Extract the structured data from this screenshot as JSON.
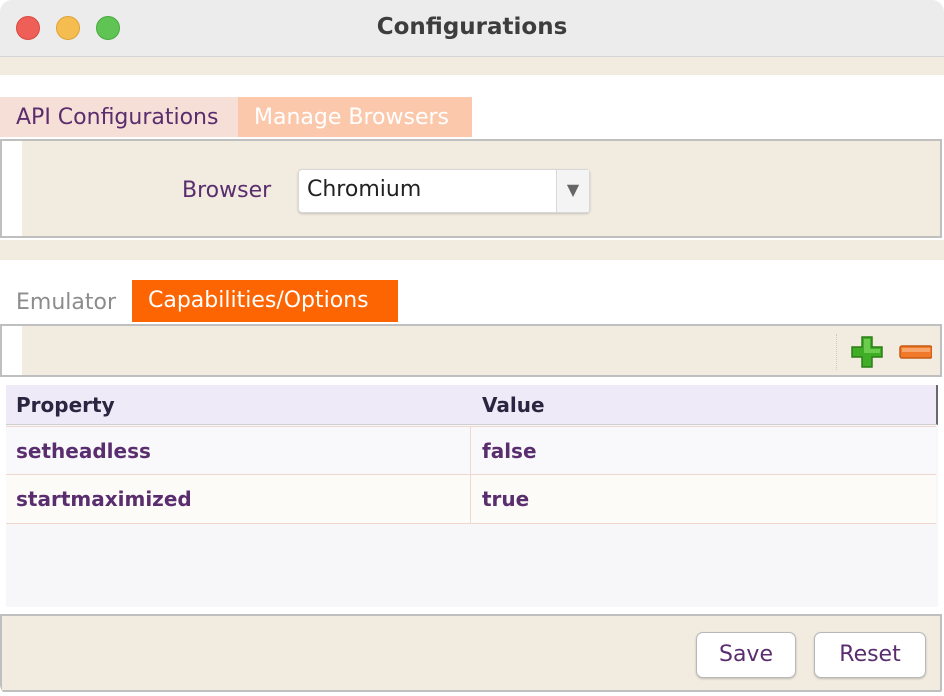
{
  "window": {
    "title": "Configurations"
  },
  "top_tabs": [
    {
      "label": "API Configurations",
      "active": false
    },
    {
      "label": "Manage Browsers",
      "active": true
    }
  ],
  "browser_panel": {
    "label": "Browser",
    "select_value": "Chromium"
  },
  "bottom_tabs": [
    {
      "label": "Emulator",
      "active": false
    },
    {
      "label": "Capabilities/Options",
      "active": true
    }
  ],
  "toolbar": {
    "add_icon": "plus-icon",
    "remove_icon": "minus-icon"
  },
  "table": {
    "columns": [
      "Property",
      "Value"
    ],
    "rows": [
      [
        "setheadless",
        "false"
      ],
      [
        "startmaximized",
        "true"
      ]
    ]
  },
  "actions": {
    "save_label": "Save",
    "reset_label": "Reset"
  },
  "colors": {
    "accent_tab": "#fd6402",
    "inactive_tab_text": "#5a2d6e",
    "panel_bg": "#f1ebe0"
  }
}
